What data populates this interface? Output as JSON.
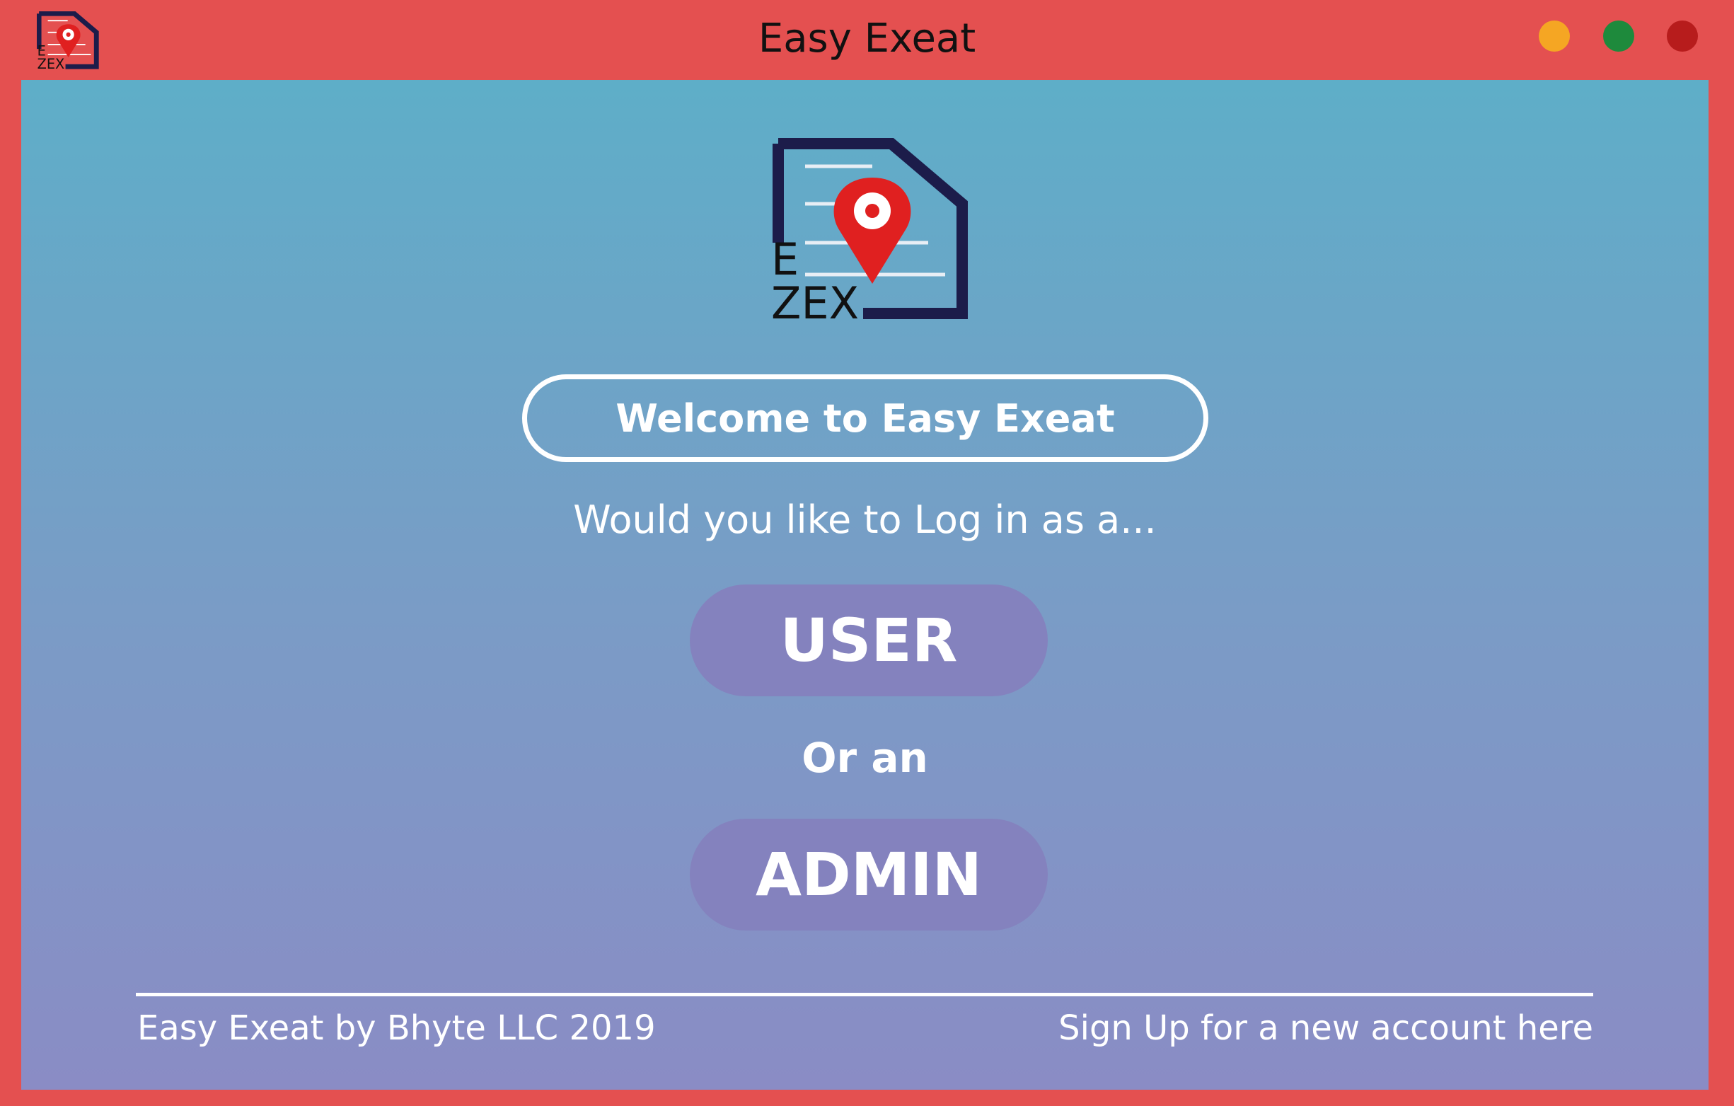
{
  "window": {
    "title": "Easy Exeat",
    "frame_color": "#e45050",
    "buttons": {
      "minimize_color": "#f5a623",
      "maximize_color": "#1e8a3c",
      "close_color": "#b71c1c"
    }
  },
  "logo": {
    "icon": "ezex-document-pin-logo",
    "text_line1": "E",
    "text_line2": "ZEX",
    "pin_color": "#e02020",
    "document_color": "#1c1c4a"
  },
  "main": {
    "welcome": "Welcome to Easy Exeat",
    "question": "Would you like to Log in as a...",
    "user_button": "USER",
    "or_text": "Or an",
    "admin_button": "ADMIN",
    "button_color": "#8482be"
  },
  "footer": {
    "copyright": "Easy Exeat by Bhyte LLC 2019",
    "signup_link": "Sign Up for a new account here"
  }
}
